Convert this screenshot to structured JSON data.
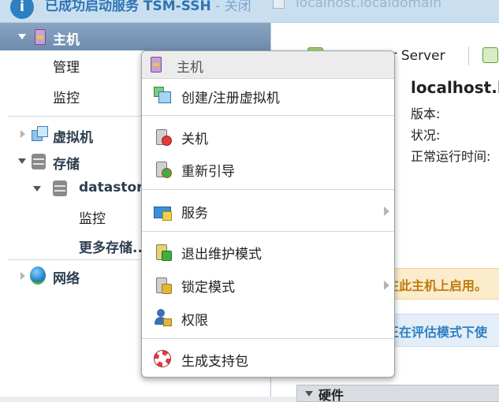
{
  "notification": {
    "message": "已成功启动服务 TSM-SSH",
    "close_label": " - 关闭",
    "right_text": "localhost.localdomain"
  },
  "navigator": {
    "host_label": "主机",
    "host_children": [
      "管理",
      "监控"
    ],
    "vm_label": "虚拟机",
    "storage_label": "存储",
    "datastore_label": "datastore",
    "datastore_children": [
      "监控",
      "更多存储..."
    ],
    "network_label": "网络"
  },
  "content": {
    "toolbar_item": "Hypervisor Server",
    "toolbar_item_visible": "er Server",
    "hostname": "localhost.lo",
    "fields": [
      "版本:",
      "状况:",
      "正常运行时间:"
    ],
    "warning_text": "在此主机上启用。",
    "eval_text": "正在评估模式下使",
    "hardware_label": "硬件"
  },
  "context_menu": {
    "header": "主机",
    "items": [
      {
        "label": "创建/注册虚拟机",
        "icon": "create-vm-icon",
        "submenu": false
      },
      {
        "label": "关机",
        "icon": "shutdown-icon",
        "submenu": false
      },
      {
        "label": "重新引导",
        "icon": "reboot-icon",
        "submenu": false
      },
      {
        "label": "服务",
        "icon": "services-icon",
        "submenu": true
      },
      {
        "label": "退出维护模式",
        "icon": "exit-maintenance-icon",
        "submenu": false
      },
      {
        "label": "锁定模式",
        "icon": "lockdown-icon",
        "submenu": true
      },
      {
        "label": "权限",
        "icon": "permissions-icon",
        "submenu": false
      },
      {
        "label": "生成支持包",
        "icon": "support-bundle-icon",
        "submenu": false
      }
    ]
  },
  "colors": {
    "accent": "#2f7fc1",
    "nav_selected": "#7b97b8",
    "warning": "#c07a0e"
  }
}
